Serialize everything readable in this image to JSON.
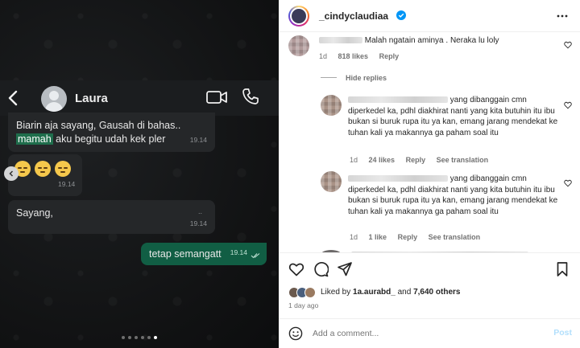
{
  "chat": {
    "contact_name": "Laura",
    "messages": [
      {
        "pre": "Biarin aja sayang, Gausah di bahas..",
        "highlight": "mamah",
        "post": " aku begitu udah kek pler",
        "time": "19.14"
      },
      {
        "time": "19.14"
      },
      {
        "text": "Sayang,",
        "extra": "..",
        "time": "19.14"
      },
      {
        "text": "tetap semangatt",
        "time": "19.14"
      }
    ],
    "carousel": {
      "count": 6,
      "active": 5
    }
  },
  "post": {
    "username": "_cindyclaudiaa",
    "comments": [
      {
        "text": "Malah ngatain aminya . Neraka lu loly",
        "age": "1d",
        "likes": "818 likes",
        "reply": "Reply"
      },
      {
        "text": "yang dibanggain cmn diperkedel ka, pdhl diakhirat nanti yang kita butuhin itu ibu bukan si buruk rupa itu ya kan, emang jarang mendekat ke tuhan kali ya makannya ga paham soal itu",
        "age": "1d",
        "likes": "24 likes",
        "reply": "Reply",
        "translate": "See translation"
      },
      {
        "text": "yang dibanggain cmn diperkedel ka, pdhl diakhirat nanti yang kita butuhin itu ibu bukan si buruk rupa itu ya kan, emang jarang mendekat ke tuhan kali ya makannya ga paham soal itu",
        "age": "1d",
        "likes": "1 like",
        "reply": "Reply",
        "translate": "See translation"
      }
    ],
    "hide_replies": "Hide replies",
    "liked_prefix": "Liked by ",
    "liked_user": "1a.aurabd_",
    "liked_mid": " and ",
    "liked_count": "7,640 others",
    "time_ago": "1 day ago",
    "add_comment_placeholder": "Add a comment...",
    "post_label": "Post"
  },
  "colors": {
    "outgoing_bubble": "#115e44",
    "incoming_bubble": "#252729",
    "verified_blue": "#0095f6",
    "post_button_disabled": "#b2dffc"
  }
}
